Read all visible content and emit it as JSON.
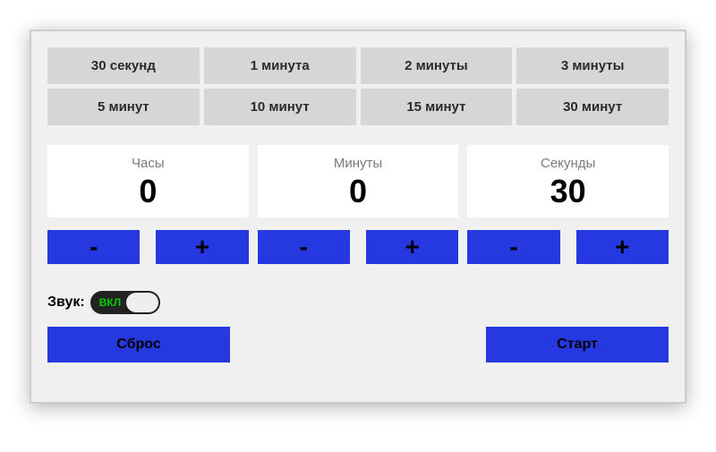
{
  "presets": [
    {
      "label": "30 секунд"
    },
    {
      "label": "1 минута"
    },
    {
      "label": "2 минуты"
    },
    {
      "label": "3 минуты"
    },
    {
      "label": "5 минут"
    },
    {
      "label": "10 минут"
    },
    {
      "label": "15 минут"
    },
    {
      "label": "30 минут"
    }
  ],
  "time": {
    "hours": {
      "label": "Часы",
      "value": "0",
      "minus": "-",
      "plus": "+"
    },
    "minutes": {
      "label": "Минуты",
      "value": "0",
      "minus": "-",
      "plus": "+"
    },
    "seconds": {
      "label": "Секунды",
      "value": "30",
      "minus": "-",
      "plus": "+"
    }
  },
  "sound": {
    "label": "Звук:",
    "state": "ВКЛ"
  },
  "actions": {
    "reset": "Сброс",
    "start": "Старт"
  }
}
